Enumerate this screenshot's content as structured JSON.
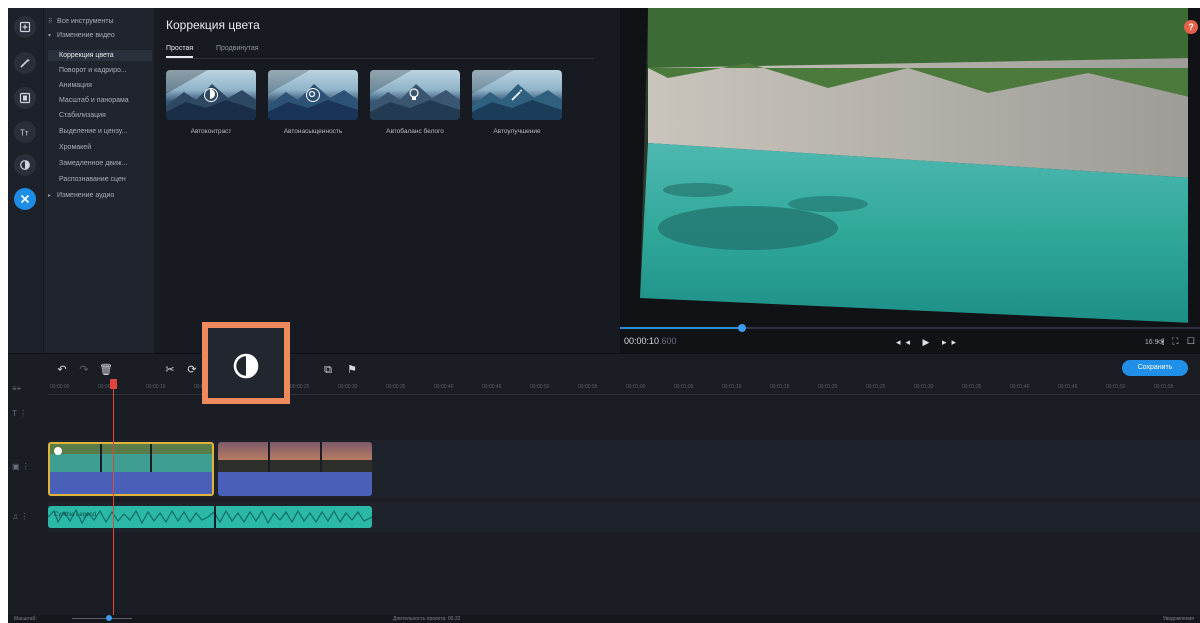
{
  "sidebar_icons": [
    "import-icon",
    "magic-icon",
    "filters-icon",
    "titles-icon",
    "transitions-icon",
    "tools-icon"
  ],
  "tools": [
    {
      "label": "Все инструменты",
      "kind": "header"
    },
    {
      "label": "Изменение видео",
      "kind": "group"
    },
    {
      "label": "Коррекция цвета",
      "kind": "item",
      "selected": true
    },
    {
      "label": "Поворот и кадриро...",
      "kind": "item"
    },
    {
      "label": "Анимация",
      "kind": "item"
    },
    {
      "label": "Масштаб и панорама",
      "kind": "item"
    },
    {
      "label": "Стабилизация",
      "kind": "item"
    },
    {
      "label": "Выделение и цензу...",
      "kind": "item"
    },
    {
      "label": "Хромакей",
      "kind": "item"
    },
    {
      "label": "Замедленное движ...",
      "kind": "item"
    },
    {
      "label": "Распознавание сцен",
      "kind": "item"
    },
    {
      "label": "Изменение аудио",
      "kind": "group-collapsed"
    }
  ],
  "panel": {
    "title": "Коррекция цвета",
    "tabs": [
      "Простая",
      "Продвинутая"
    ],
    "active_tab": "Простая",
    "presets": [
      {
        "label": "Автоконтраст",
        "icon": "contrast-icon"
      },
      {
        "label": "Автонасыщенность",
        "icon": "saturation-icon"
      },
      {
        "label": "Автобаланс белого",
        "icon": "white-balance-icon"
      },
      {
        "label": "Автоулучшение",
        "icon": "magic-wand-icon"
      }
    ]
  },
  "preview": {
    "help": "?",
    "timecode": "00:00:10",
    "timecode_ms": ".600",
    "progress": 0.21,
    "transport": "◂◂ ▶ ▸▸",
    "ratio": "16:9 ▾",
    "icons": "◁ ⛶ ☐"
  },
  "timeline": {
    "save_label": "Сохранить",
    "ruler_ticks": [
      "00:00:00",
      "00:00:05",
      "00:00:10",
      "00:00:15",
      "00:00:20",
      "00:00:25",
      "00:00:30",
      "00:00:35",
      "00:00:40",
      "00:00:45",
      "00:00:50",
      "00:00:55",
      "00:01:00",
      "00:01:05",
      "00:01:10",
      "00:01:15",
      "00:01:20",
      "00:01:25",
      "00:01:30",
      "00:01:35",
      "00:01:40",
      "00:01:45",
      "00:01:50",
      "00:01:55"
    ],
    "audio_clip_label": "Cynthia Legend"
  },
  "status": {
    "scale_label": "Масштаб:",
    "duration_label": "Длительность проекта: 00:32",
    "notifications_label": "Уведомления"
  },
  "colors": {
    "accent": "#1f8fe8",
    "callout": "#ef8a5c",
    "playhead": "#e0473c",
    "clip_border": "#e0b43a",
    "video_track": "#4a5fb8",
    "audio_track": "#2bb8a6"
  }
}
